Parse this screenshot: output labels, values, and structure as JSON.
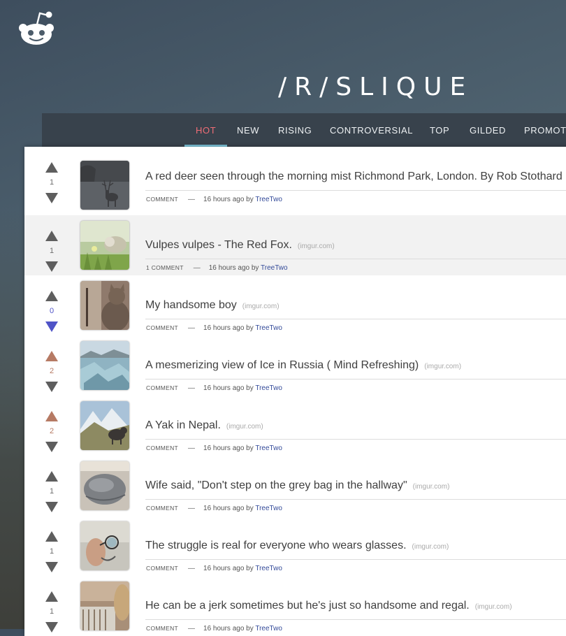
{
  "header": {
    "title": "/R/SLIQUE",
    "logo_icon": "reddit-alien-logo"
  },
  "nav": {
    "tabs": [
      "HOT",
      "NEW",
      "RISING",
      "CONTROVERSIAL",
      "TOP",
      "GILDED",
      "PROMOTED"
    ],
    "active": "HOT"
  },
  "colors": {
    "active_tab": "#ef6d76",
    "tab_underline": "#7cc3d8",
    "upvoted": "#b67a64",
    "downvoted": "#4f53c7",
    "author_link": "#334a99"
  },
  "posts": [
    {
      "title": "A red deer seen through the morning mist Richmond Park, London. By Rob Stothard",
      "domain": "",
      "score": "1",
      "vote": "none",
      "comments": "COMMENT",
      "time": "16 hours ago by",
      "author": "TreeTwo",
      "thumb_icon": "deer-in-mist-thumbnail"
    },
    {
      "title": "Vulpes vulpes - The Red Fox.",
      "domain": "(imgur.com)",
      "score": "1",
      "vote": "none",
      "comments": "1 COMMENT",
      "time": "16 hours ago by",
      "author": "TreeTwo",
      "thumb_icon": "fox-in-grass-thumbnail"
    },
    {
      "title": "My handsome boy",
      "domain": "(imgur.com)",
      "score": "0",
      "vote": "down",
      "comments": "COMMENT",
      "time": "16 hours ago by",
      "author": "TreeTwo",
      "thumb_icon": "cat-thumbnail"
    },
    {
      "title": "A mesmerizing view of Ice in Russia ( Mind Refreshing)",
      "domain": "(imgur.com)",
      "score": "2",
      "vote": "up",
      "comments": "COMMENT",
      "time": "16 hours ago by",
      "author": "TreeTwo",
      "thumb_icon": "ice-landscape-thumbnail"
    },
    {
      "title": "A Yak in Nepal.",
      "domain": "(imgur.com)",
      "score": "2",
      "vote": "up",
      "comments": "COMMENT",
      "time": "16 hours ago by",
      "author": "TreeTwo",
      "thumb_icon": "yak-mountains-thumbnail"
    },
    {
      "title": "Wife said, \"Don't step on the grey bag in the hallway\"",
      "domain": "(imgur.com)",
      "score": "1",
      "vote": "none",
      "comments": "COMMENT",
      "time": "16 hours ago by",
      "author": "TreeTwo",
      "thumb_icon": "grey-bag-thumbnail"
    },
    {
      "title": "The struggle is real for everyone who wears glasses.",
      "domain": "(imgur.com)",
      "score": "1",
      "vote": "none",
      "comments": "COMMENT",
      "time": "16 hours ago by",
      "author": "TreeTwo",
      "thumb_icon": "hand-glasses-thumbnail"
    },
    {
      "title": "He can be a jerk sometimes but he's just so handsome and regal.",
      "domain": "(imgur.com)",
      "score": "1",
      "vote": "none",
      "comments": "COMMENT",
      "time": "16 hours ago by",
      "author": "TreeTwo",
      "thumb_icon": "animal-portrait-thumbnail"
    }
  ]
}
